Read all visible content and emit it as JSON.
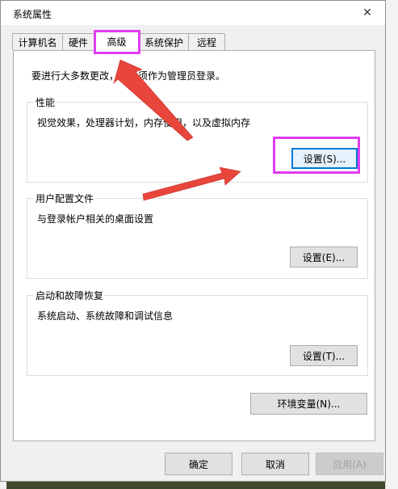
{
  "window": {
    "title": "系统属性",
    "close_glyph": "✕"
  },
  "tabs": [
    {
      "label": "计算机名"
    },
    {
      "label": "硬件"
    },
    {
      "label": "高级"
    },
    {
      "label": "系统保护"
    },
    {
      "label": "远程"
    }
  ],
  "active_tab": "高级",
  "notice": "要进行大多数更改，你必须作为管理员登录。",
  "performance": {
    "title": "性能",
    "description": "视觉效果，处理器计划，内存使用，以及虚拟内存",
    "button": "设置(S)..."
  },
  "user_profiles": {
    "title": "用户配置文件",
    "description": "与登录帐户相关的桌面设置",
    "button": "设置(E)..."
  },
  "startup_recovery": {
    "title": "启动和故障恢复",
    "description": "系统启动、系统故障和调试信息",
    "button": "设置(T)..."
  },
  "env_button": "环境变量(N)...",
  "footer": {
    "ok": "确定",
    "cancel": "取消",
    "apply": "应用(A)"
  },
  "colors": {
    "highlight": "#e13cf0",
    "arrow": "#e8453c",
    "focus_border": "#0078d7"
  }
}
